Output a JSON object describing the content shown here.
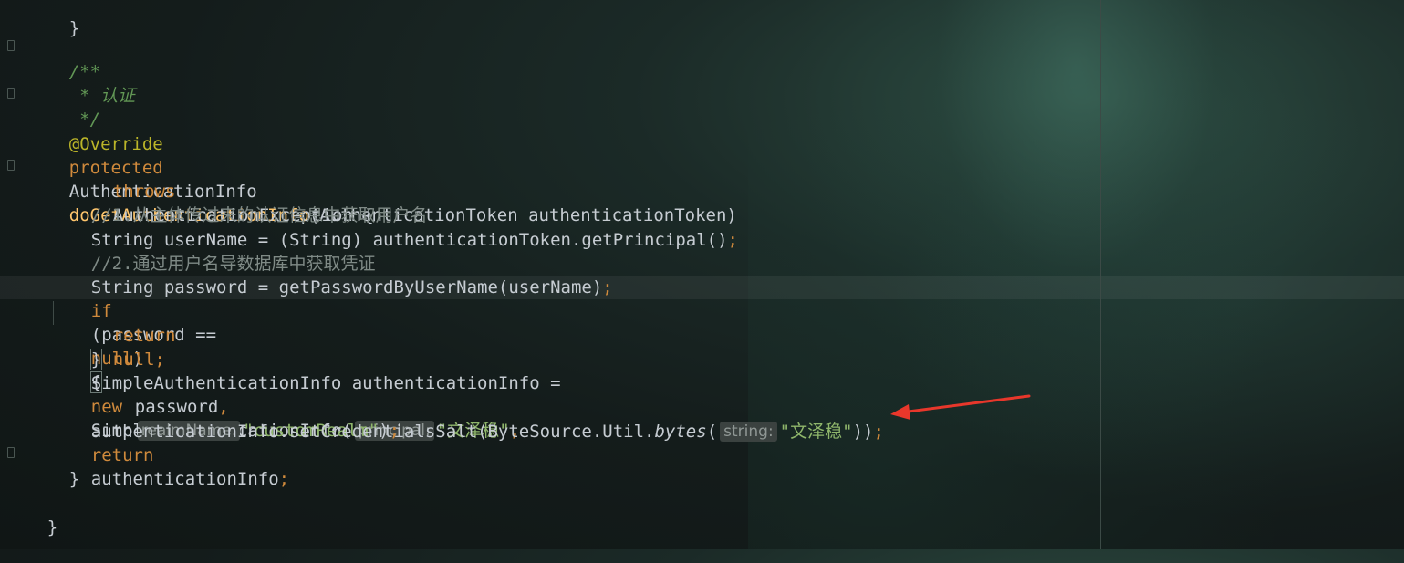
{
  "editor": {
    "lines": {
      "l0": "}",
      "l2": "/**",
      "l3": " * 认证",
      "l4": " */",
      "l5_ann": "@Override",
      "l6_kw": "protected",
      "l6_type": "AuthenticationInfo",
      "l6_method": "doGetAuthenticationInfo",
      "l6_params": "(AuthenticationToken authenticationToken)",
      "l7_kw": "throws",
      "l7_rest": "AuthenticationException {",
      "l8_comment": "//1.从主体传过来的认证信息中获取用户名",
      "l9_code": "String userName = (String) authenticationToken.getPrincipal()",
      "l9_semi": ";",
      "l10_comment": "//2.通过用户名导数据库中获取凭证",
      "l11_code": "String password = getPasswordByUserName(userName)",
      "l11_semi": ";",
      "l12_kw1": "if",
      "l12_mid": "(password ==",
      "l12_kw2": "null",
      "l12_end": ")",
      "l12_brace": "{",
      "l13_kw1": "return",
      "l13_kw2": "null",
      "l13_semi": ";",
      "l14": "}",
      "l15_a": "SimpleAuthenticationInfo authenticationInfo =",
      "l15_new": "new",
      "l15_b": "SimpleAuthenticationInfo(",
      "l15_hint": "principal:",
      "l15_str": "\"文泽稳\"",
      "l15_comma": ",",
      "l16_a": "password",
      "l16_comma": ",",
      "l16_hint": "realmName:",
      "l16_str": "\"customRealm\"",
      "l16_end": ")",
      "l16_semi": ";",
      "l17_a": "authenticationInfo.setCredentialsSalt(ByteSource.Util.",
      "l17_it": "bytes",
      "l17_paren": "(",
      "l17_hint": "string:",
      "l17_str": "\"文泽稳\"",
      "l17_end": "))",
      "l17_semi": ";",
      "l18_kw": "return",
      "l18_rest": "authenticationInfo",
      "l18_semi": ";",
      "l19": "}",
      "l21": "}"
    },
    "colors": {
      "keyword": "#d08a3c",
      "method": "#ffc66d",
      "string": "#8fb66b",
      "comment": "#7f8a86",
      "doc_comment": "#629755",
      "annotation": "#bbb529",
      "arrow": "#e8372b"
    },
    "arrow_icon": "red-annotation-arrow"
  }
}
